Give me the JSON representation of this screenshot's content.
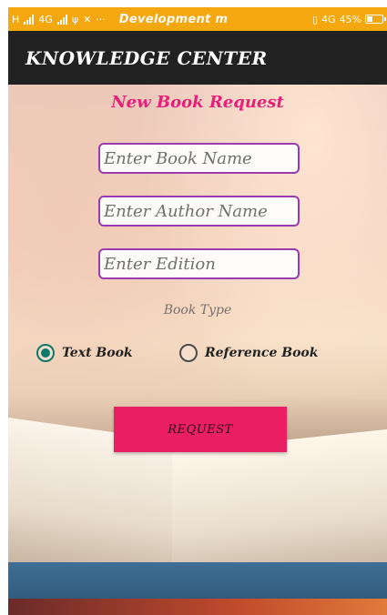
{
  "status_bar": {
    "left_network": "H",
    "left_network2": "4G",
    "notification_text": "Development m",
    "right_network": "4G",
    "battery": "45%",
    "battery_level": 0.45
  },
  "app_bar": {
    "title": "KNOWLEDGE CENTER"
  },
  "form": {
    "title": "New Book Request",
    "book_name_placeholder": "Enter Book Name",
    "author_name_placeholder": "Enter Author Name",
    "edition_placeholder": "Enter Edition",
    "book_type_label": "Book Type",
    "book_type_options": [
      "Text Book",
      "Reference Book"
    ],
    "selected_book_type": "Text Book",
    "request_button": "REQUEST"
  },
  "colors": {
    "status_bar": "#f5a70f",
    "app_bar": "#212121",
    "accent_pink": "#e91e63",
    "title_pink": "#e91e7a",
    "field_border": "#9b3bb0",
    "radio_checked": "#0c7a6a"
  },
  "icons": [
    "signal-icon",
    "usb-icon",
    "tools-icon",
    "more-icon",
    "vibrate-icon",
    "battery-icon"
  ]
}
